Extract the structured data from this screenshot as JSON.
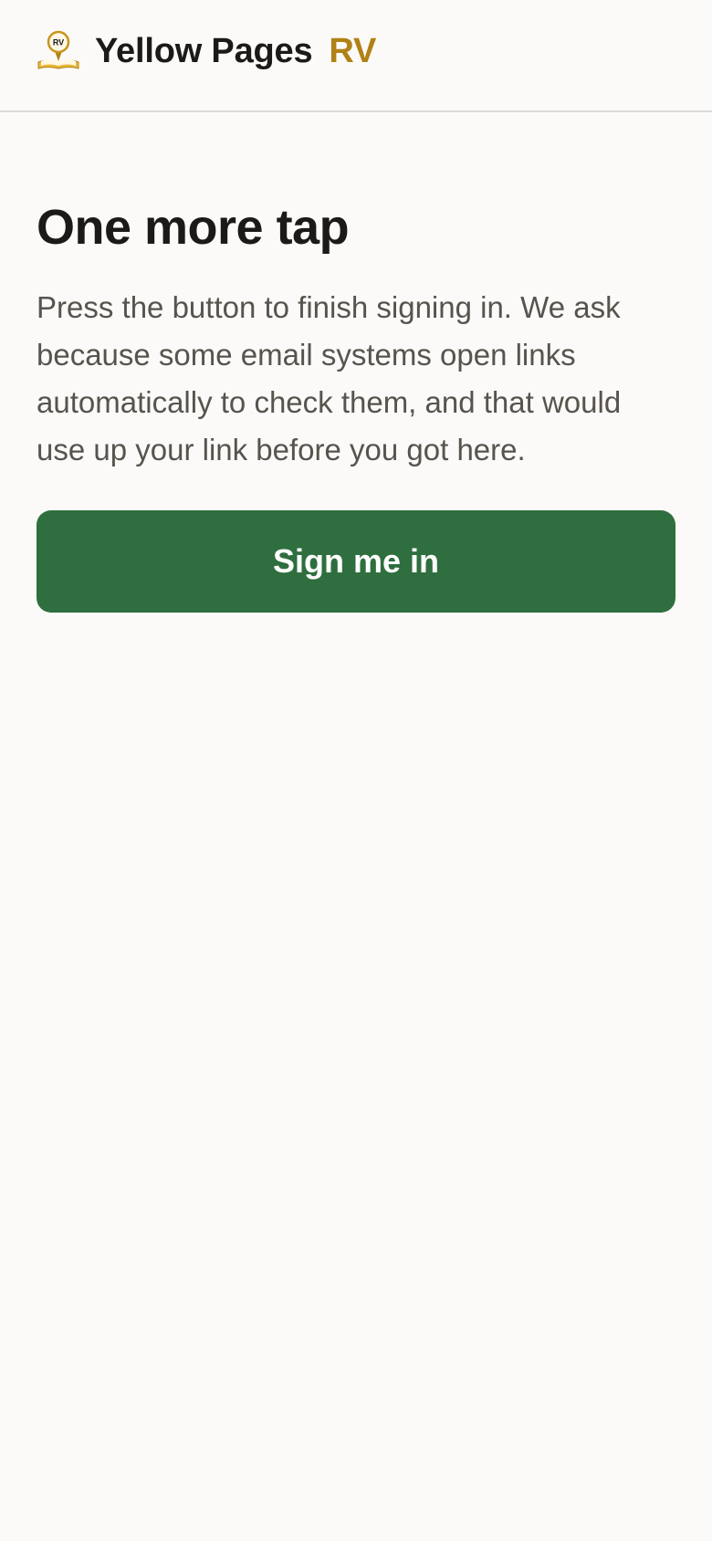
{
  "header": {
    "brand_name": "Yellow Pages",
    "brand_suffix": "RV",
    "logo_icon": "rv-map-pin-book-icon",
    "logo_text": "RV"
  },
  "main": {
    "title": "One more tap",
    "description": "Press the button to finish signing in. We ask because some email systems open links automatically to check them, and that would use up your link before you got here.",
    "button_label": "Sign me in"
  },
  "colors": {
    "background": "#fbfaf8",
    "accent_gold": "#b08216",
    "button_green": "#2f6e3f",
    "title_text": "#1b1a17",
    "body_text": "#58534d"
  }
}
